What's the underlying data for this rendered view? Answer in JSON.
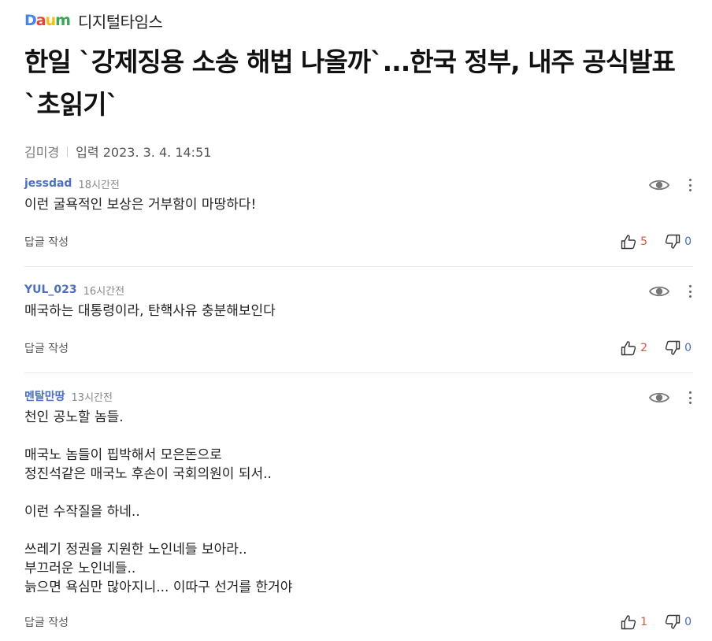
{
  "brand": {
    "logo_letters": [
      "D",
      "a",
      "u",
      "m"
    ],
    "logo_colors": [
      "#4285f4",
      "#ea4335",
      "#fbbc05",
      "#34a853"
    ],
    "outlet": "디지털타임스"
  },
  "article": {
    "title": "한일 `강제징용 소송 해법 나올까`...한국 정부, 내주 공식발표 `초읽기`",
    "author": "김미경",
    "published_label": "입력",
    "published_date": "2023. 3. 4. 14:51"
  },
  "comments": [
    {
      "author": "jessdad",
      "time": "18시간전",
      "text": "이런 굴욕적인 보상은 거부함이 마땅하다!",
      "reply_label": "답글 작성",
      "likes": "5",
      "dislikes": "0"
    },
    {
      "author": "YUL_023",
      "time": "16시간전",
      "text": "매국하는 대통령이라, 탄핵사유 충분해보인다",
      "reply_label": "답글 작성",
      "likes": "2",
      "dislikes": "0"
    },
    {
      "author": "멘탈만땅",
      "time": "13시간전",
      "text": "천인 공노할 놈들.\n\n매국노 놈들이 핍박해서 모은돈으로\n정진석같은 매국노 후손이 국회의원이 되서..\n\n이런 수작질을 하네..\n\n쓰레기 정권을 지원한 노인네들 보아라..\n부끄러운 노인네들..\n늙으면 욕심만 많아지니... 이따구 선거를 한거야",
      "reply_label": "답글 작성",
      "likes": "1",
      "dislikes": "0"
    }
  ],
  "icons": {
    "view": "eye-icon",
    "more": "more-vertical-icon",
    "like": "thumbs-up-icon",
    "dislike": "thumbs-down-icon"
  },
  "colors": {
    "author": "#4a6fc4",
    "like_count": "#e0563c",
    "dislike_count": "#4a6fc4"
  }
}
